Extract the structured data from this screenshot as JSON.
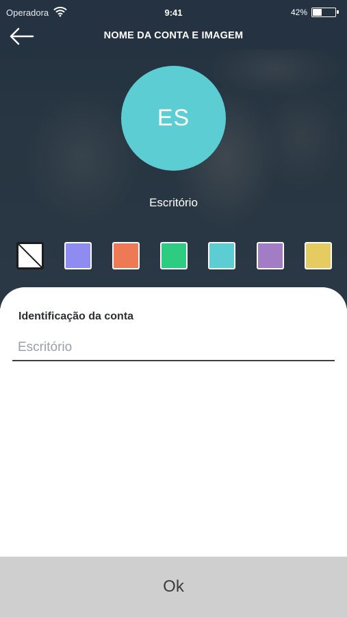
{
  "status_bar": {
    "carrier": "Operadora",
    "time": "9:41",
    "battery_percent": "42%",
    "battery_level": 0.42
  },
  "nav": {
    "title": "NOME DA CONTA E IMAGEM",
    "back_icon": "arrow-left-icon"
  },
  "avatar": {
    "initials": "ES",
    "color": "#5dcdd4"
  },
  "account": {
    "name": "Escritório"
  },
  "swatches": [
    {
      "name": "none",
      "color": "#ffffff",
      "selected": true
    },
    {
      "name": "blue-violet",
      "color": "#8e8cf0",
      "selected": false
    },
    {
      "name": "orange",
      "color": "#ee7a55",
      "selected": false
    },
    {
      "name": "green",
      "color": "#2ecc80",
      "selected": false
    },
    {
      "name": "teal",
      "color": "#5dcdd4",
      "selected": false
    },
    {
      "name": "purple",
      "color": "#a37cc6",
      "selected": false
    },
    {
      "name": "yellow",
      "color": "#e6cb60",
      "selected": false
    }
  ],
  "form": {
    "label": "Identificação da conta",
    "placeholder": "Escritório",
    "value": ""
  },
  "footer": {
    "ok_label": "Ok"
  }
}
